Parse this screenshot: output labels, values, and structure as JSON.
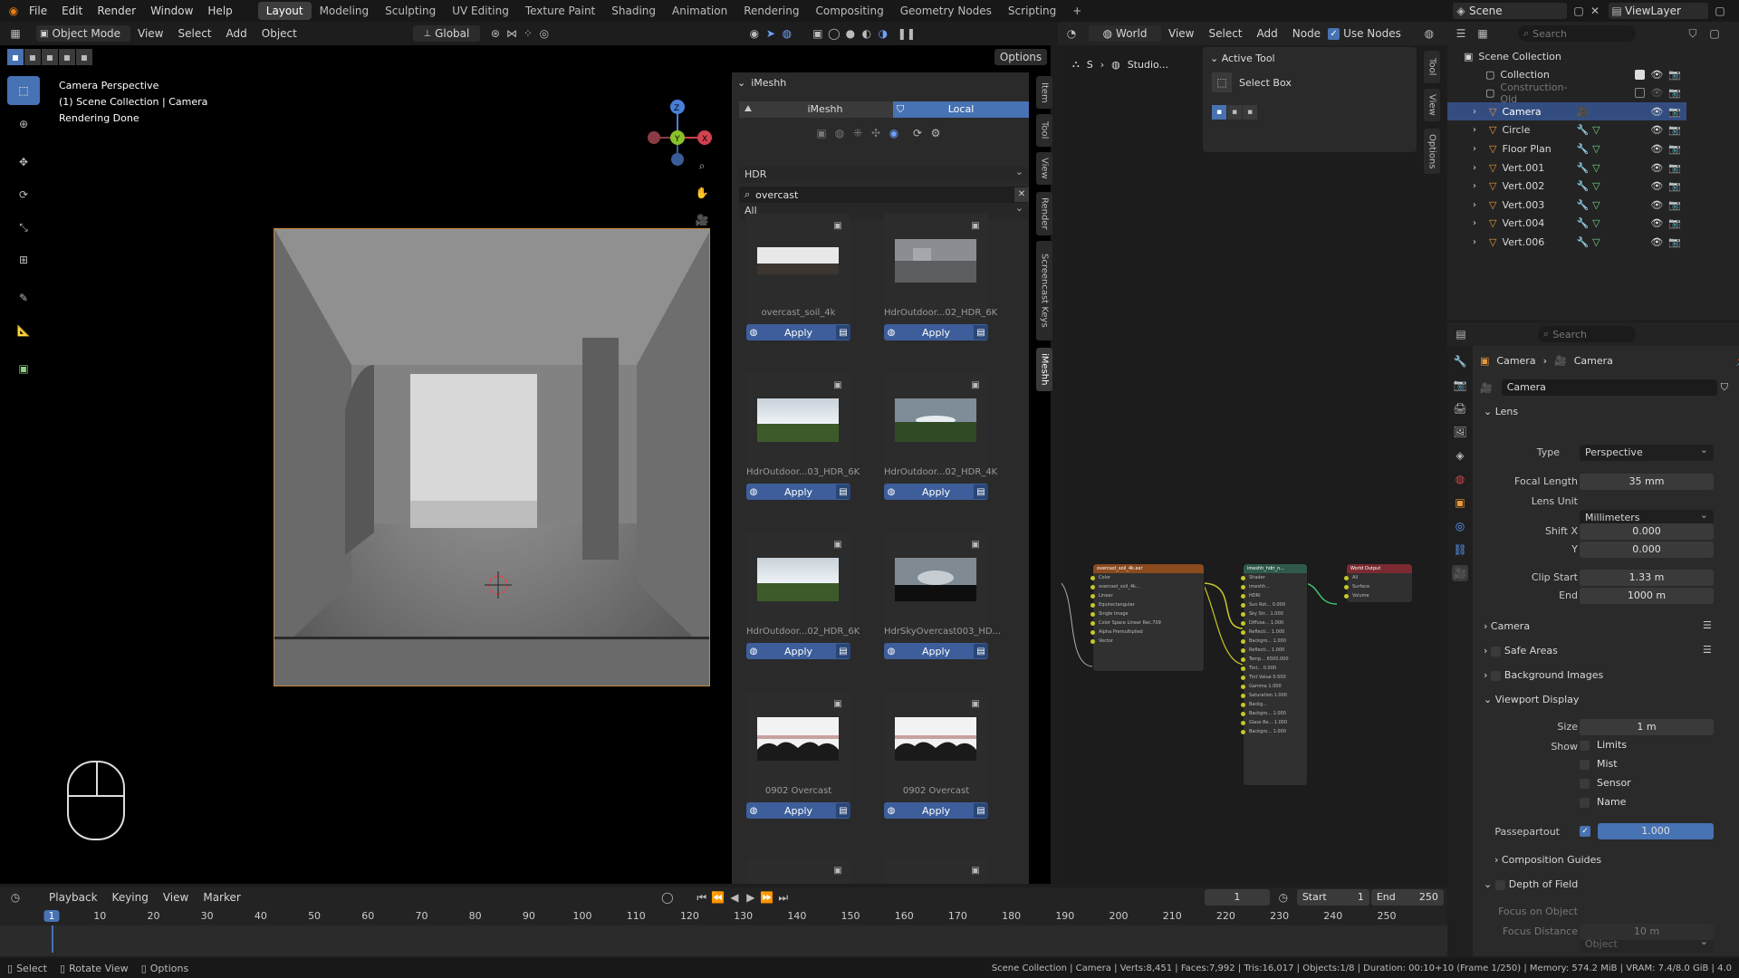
{
  "topbar": {
    "menus": [
      "File",
      "Edit",
      "Render",
      "Window",
      "Help"
    ],
    "workspaces": [
      "Layout",
      "Modeling",
      "Sculpting",
      "UV Editing",
      "Texture Paint",
      "Shading",
      "Animation",
      "Rendering",
      "Compositing",
      "Geometry Nodes",
      "Scripting"
    ],
    "active_workspace": "Layout",
    "add_tab": "+",
    "scene": "Scene",
    "view_layer": "ViewLayer"
  },
  "viewport": {
    "mode": "Object Mode",
    "menus": [
      "View",
      "Select",
      "Add",
      "Object"
    ],
    "transform": "Global",
    "options": "Options",
    "overlay_lines": [
      "Camera Perspective",
      "(1) Scene Collection | Camera",
      "Rendering Done"
    ],
    "gizmo_axes": [
      "X",
      "Y",
      "Z"
    ]
  },
  "imeshh": {
    "title": "iMeshh",
    "tab_imeshh": "iMeshh",
    "tab_local": "Local",
    "category": "HDR",
    "filter": "All",
    "search": "overcast",
    "apply_label": "Apply",
    "assets": [
      {
        "name": "overcast_soil_4k",
        "thumb": "pano-ground"
      },
      {
        "name": "HdrOutdoor...02_HDR_6K",
        "thumb": "pano-grey"
      },
      {
        "name": "HdrOutdoor...03_HDR_6K",
        "thumb": "sky-green"
      },
      {
        "name": "HdrOutdoor...02_HDR_4K",
        "thumb": "sky-green-dark"
      },
      {
        "name": "HdrOutdoor...02_HDR_6K",
        "thumb": "sky-green"
      },
      {
        "name": "HdrSkyOvercast003_HD...",
        "thumb": "sky-dark"
      },
      {
        "name": "0902 Overcast",
        "thumb": "arches"
      },
      {
        "name": "0902 Overcast",
        "thumb": "arches"
      }
    ]
  },
  "side_tabs": [
    "Item",
    "Tool",
    "View",
    "Render",
    "Screencast Keys",
    "iMeshh"
  ],
  "node_editor": {
    "world": "World",
    "menus": [
      "View",
      "Select",
      "Add",
      "Node"
    ],
    "use_nodes": "Use Nodes",
    "breadcrumb": [
      "S",
      "Studio..."
    ],
    "active_tool_title": "Active Tool",
    "active_tool": "Select Box",
    "tabs": [
      "Tool",
      "View",
      "Options"
    ],
    "nodes": {
      "env": {
        "title": "overcast_soil_4k.exr",
        "rows": [
          "Color",
          "overcast_soil_4k...",
          "Linear",
          "Equirectangular",
          "Single Image",
          "Color Space   Linear Rec.709",
          "Alpha   Premultiplied",
          "Vector"
        ]
      },
      "bg": {
        "title": "imeshh_hdri_n...",
        "rows": [
          "Shader",
          "imeshh...",
          "HDRI",
          "Sun Rot... 0.000",
          "Sky Str... 1.000",
          "Diffuse... 1.000",
          "Reflecti... 1.000",
          "Backgro... 1.000",
          "Reflecti... 1.000",
          "Temp... 6500.000",
          "Tint... 0.000",
          "Tint Value 0.500",
          "Gamma 1.000",
          "Saturation 1.000",
          "Backg...",
          "Backgro... 1.000",
          "Glass Re... 1.000",
          "Backgro... 1.000"
        ]
      },
      "out": {
        "title": "World Output",
        "rows": [
          "All",
          "Surface",
          "Volume"
        ]
      }
    }
  },
  "outliner": {
    "search_placeholder": "Search",
    "root": "Scene Collection",
    "items": [
      {
        "name": "Collection",
        "indent": 0,
        "type": "collection"
      },
      {
        "name": "Construction-Old",
        "indent": 0,
        "type": "collection-dim"
      },
      {
        "name": "Camera",
        "indent": 1,
        "type": "camera",
        "selected": true
      },
      {
        "name": "Circle",
        "indent": 1,
        "type": "mesh"
      },
      {
        "name": "Floor Plan",
        "indent": 1,
        "type": "mesh"
      },
      {
        "name": "Vert.001",
        "indent": 1,
        "type": "mesh"
      },
      {
        "name": "Vert.002",
        "indent": 1,
        "type": "mesh"
      },
      {
        "name": "Vert.003",
        "indent": 1,
        "type": "mesh"
      },
      {
        "name": "Vert.004",
        "indent": 1,
        "type": "mesh"
      },
      {
        "name": "Vert.006",
        "indent": 1,
        "type": "mesh"
      }
    ]
  },
  "properties": {
    "search_placeholder": "Search",
    "breadcrumb": [
      "Camera",
      "Camera"
    ],
    "datablock": "Camera",
    "lens": {
      "title": "Lens",
      "type_label": "Type",
      "type": "Perspective",
      "focal_label": "Focal Length",
      "focal": "35 mm",
      "unit_label": "Lens Unit",
      "unit": "Millimeters",
      "shiftx_label": "Shift X",
      "shiftx": "0.000",
      "shifty_label": "Y",
      "shifty": "0.000",
      "clipstart_label": "Clip Start",
      "clipstart": "1.33 m",
      "clipend_label": "End",
      "clipend": "1000 m"
    },
    "panels": [
      "Camera",
      "Safe Areas",
      "Background Images"
    ],
    "viewport_display": {
      "title": "Viewport Display",
      "size_label": "Size",
      "size": "1 m",
      "show_label": "Show",
      "shows": [
        "Limits",
        "Mist",
        "Sensor",
        "Name"
      ],
      "passepartout_label": "Passepartout",
      "passepartout": "1.000",
      "passepartout_fill": 1.0
    },
    "composition": "Composition Guides",
    "dof": {
      "title": "Depth of Field",
      "focus_obj_label": "Focus on Object",
      "focus_obj": "Object",
      "focus_dist_label": "Focus Distance",
      "focus_dist": "10 m"
    }
  },
  "timeline": {
    "menus": [
      "Playback",
      "Keying",
      "View",
      "Marker"
    ],
    "current": "1",
    "start_label": "Start",
    "start": "1",
    "end_label": "End",
    "end": "250",
    "ticks": [
      "1",
      "10",
      "20",
      "30",
      "40",
      "50",
      "60",
      "70",
      "80",
      "90",
      "100",
      "110",
      "120",
      "130",
      "140",
      "150",
      "160",
      "170",
      "180",
      "190",
      "200",
      "210",
      "220",
      "230",
      "240",
      "250"
    ]
  },
  "statusbar": {
    "left": [
      "Select",
      "Rotate View",
      "Options"
    ],
    "stats": "Scene Collection | Camera | Verts:8,451 | Faces:7,992 | Tris:16,017 | Objects:1/8 | Duration: 00:10+10 (Frame 1/250) | Memory: 574.2 MiB | VRAM: 7.4/8.0 GiB | 4.0"
  },
  "colors": {
    "accent": "#4772b3",
    "apply": "#3d5e9b",
    "selected_row": "#334d80",
    "camera_border": "#c98a3c"
  }
}
